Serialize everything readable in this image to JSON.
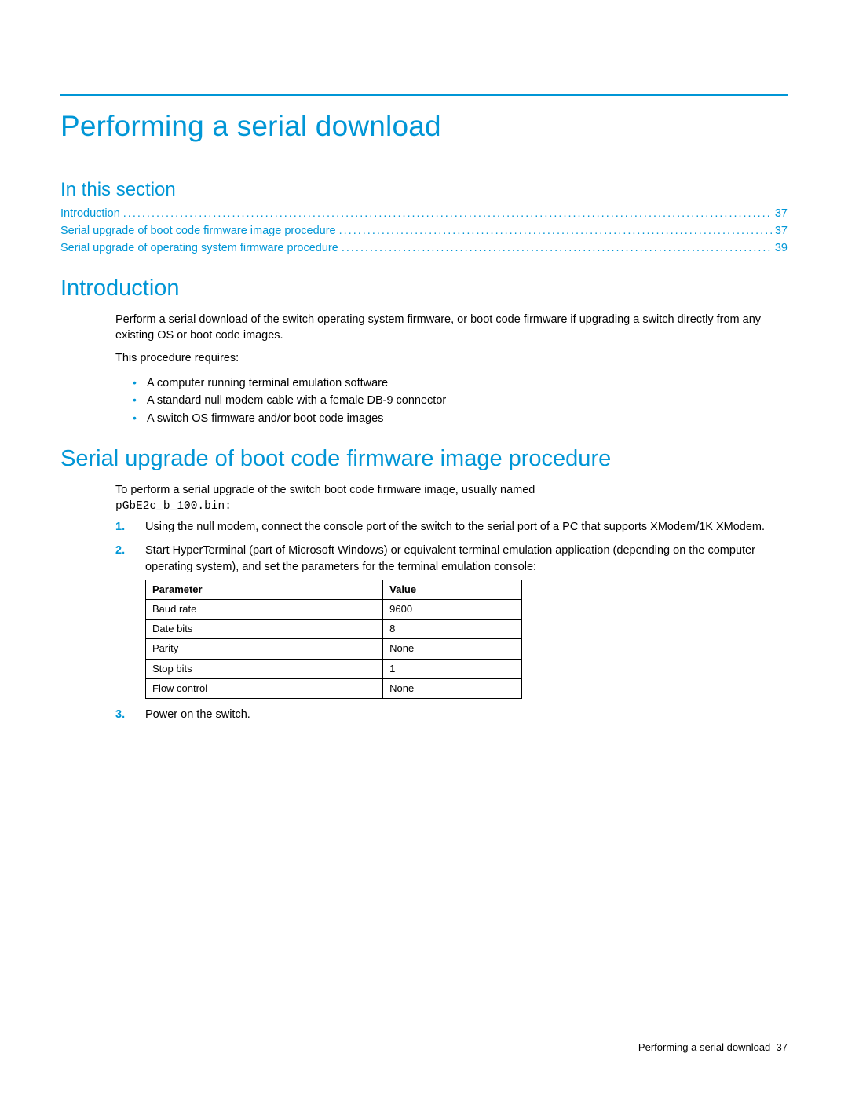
{
  "page_title": "Performing a serial download",
  "in_this_section_heading": "In this section",
  "toc": [
    {
      "label": "Introduction",
      "page": "37"
    },
    {
      "label": "Serial upgrade of boot code firmware image procedure",
      "page": "37"
    },
    {
      "label": "Serial upgrade of operating system firmware procedure",
      "page": "39"
    }
  ],
  "intro_heading": "Introduction",
  "intro_para": "Perform a serial download of the switch operating system firmware, or boot code firmware if upgrading a switch directly from any existing OS or boot code images.",
  "intro_requires": "This procedure requires:",
  "intro_bullets": [
    "A computer running terminal emulation software",
    "A standard null modem cable with a female DB-9 connector",
    "A switch OS firmware and/or boot code images"
  ],
  "proc_heading": "Serial upgrade of boot code firmware image procedure",
  "proc_para_lead": "To perform a serial upgrade of the switch boot code firmware image, usually named",
  "proc_filename": "pGbE2c_b_100.bin:",
  "proc_steps": [
    "Using the null modem, connect the console port of the switch to the serial port of a PC that supports XModem/1K XModem.",
    "Start HyperTerminal (part of Microsoft Windows) or equivalent terminal emulation application (depending on the computer operating system), and set the parameters for the terminal emulation console:",
    "Power on the switch."
  ],
  "table": {
    "headers": [
      "Parameter",
      "Value"
    ],
    "rows": [
      [
        "Baud rate",
        "9600"
      ],
      [
        "Date bits",
        "8"
      ],
      [
        "Parity",
        "None"
      ],
      [
        "Stop bits",
        "1"
      ],
      [
        "Flow control",
        "None"
      ]
    ]
  },
  "footer_text": "Performing a serial download",
  "footer_page": "37"
}
